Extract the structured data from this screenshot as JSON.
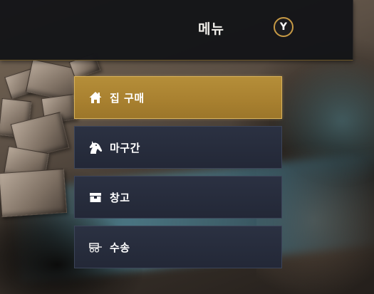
{
  "header": {
    "title": "메뉴",
    "button_hint": "Y"
  },
  "menu": {
    "items": [
      {
        "label": "집 구매",
        "icon": "house-icon",
        "selected": true
      },
      {
        "label": "마구간",
        "icon": "horse-head-icon",
        "selected": false
      },
      {
        "label": "창고",
        "icon": "storage-chest-icon",
        "selected": false
      },
      {
        "label": "수송",
        "icon": "wagon-icon",
        "selected": false
      }
    ]
  },
  "colors": {
    "accent_gold": "#b58e39",
    "panel_dark": "#2b3142",
    "header_bg": "#141518"
  }
}
